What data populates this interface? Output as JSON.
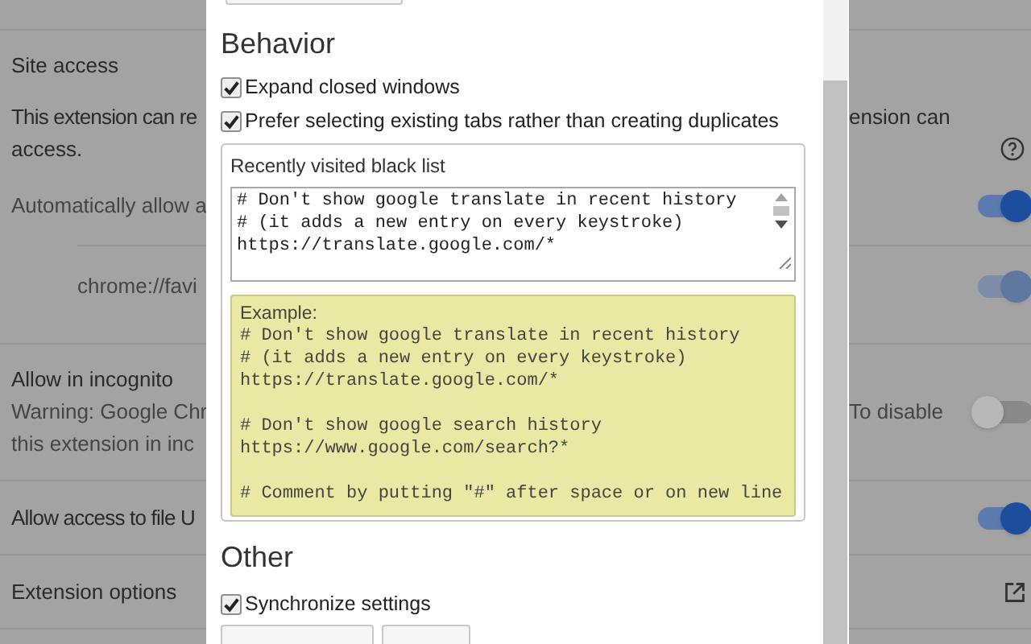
{
  "background_page": {
    "site_access": {
      "title": "Site access",
      "description_start": "This extension can re",
      "description_end": "ension can",
      "description_line2": "access.",
      "auto_allow": {
        "label": "Automatically allow a",
        "on": true
      },
      "site": {
        "label": "chrome://favi",
        "on": true,
        "disabled": true
      }
    },
    "incognito": {
      "title": "Allow in incognito",
      "warning_start": "Warning: Google Chr",
      "warning_end": "To disable",
      "warning_line2": "this extension in inc",
      "on": false
    },
    "file_access": {
      "label": "Allow access to file U",
      "on": true
    },
    "extension_options": {
      "label": "Extension options"
    }
  },
  "dialog": {
    "behavior": {
      "heading": "Behavior",
      "options": [
        {
          "label": "Expand closed windows",
          "checked": true
        },
        {
          "label": "Prefer selecting existing tabs rather than creating duplicates",
          "checked": true
        }
      ]
    },
    "blacklist": {
      "legend": "Recently visited black list",
      "value": "# Don't show google translate in recent history\n# (it adds a new entry on every keystroke)\nhttps://translate.google.com/*",
      "example_title": "Example:",
      "example_blocks": [
        "# Don't show google translate in recent history\n# (it adds a new entry on every keystroke)\nhttps://translate.google.com/*",
        "# Don't show google search history\nhttps://www.google.com/search?*",
        "# Comment by putting \"#\" after space or on new line"
      ]
    },
    "other": {
      "heading": "Other",
      "options": [
        {
          "label": "Synchronize settings",
          "checked": true
        }
      ]
    }
  }
}
